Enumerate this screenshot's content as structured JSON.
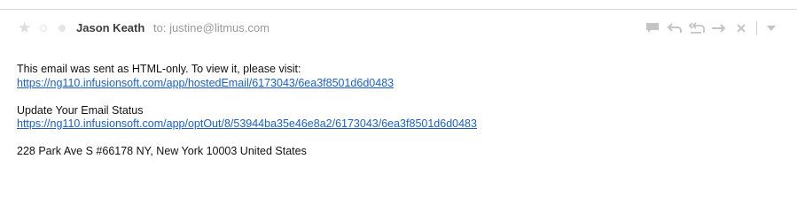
{
  "header": {
    "sender_name": "Jason Keath",
    "recipient_line": "to: justine@litmus.com"
  },
  "toolbar": {
    "items": [
      {
        "name": "comment-icon"
      },
      {
        "name": "reply-icon"
      },
      {
        "name": "reply-all-icon"
      },
      {
        "name": "forward-icon"
      },
      {
        "name": "close-icon"
      },
      {
        "name": "chevron-down-icon"
      }
    ]
  },
  "body": {
    "html_only_text": "This email was sent as HTML-only. To view it, please visit:",
    "hosted_link": "https://ng110.infusionsoft.com/app/hostedEmail/6173043/6ea3f8501d6d0483",
    "update_status_text": "Update Your Email Status",
    "optout_link": "https://ng110.infusionsoft.com/app/optOut/8/53944ba35e46e8a2/6173043/6ea3f8501d6d0483",
    "address": "228 Park Ave S #66178 NY, New York 10003 United States"
  },
  "colors": {
    "link": "#1a5fcf",
    "icon": "#c4c4c4",
    "sender": "#3d3d3d",
    "recipient": "#9a9a9a"
  }
}
